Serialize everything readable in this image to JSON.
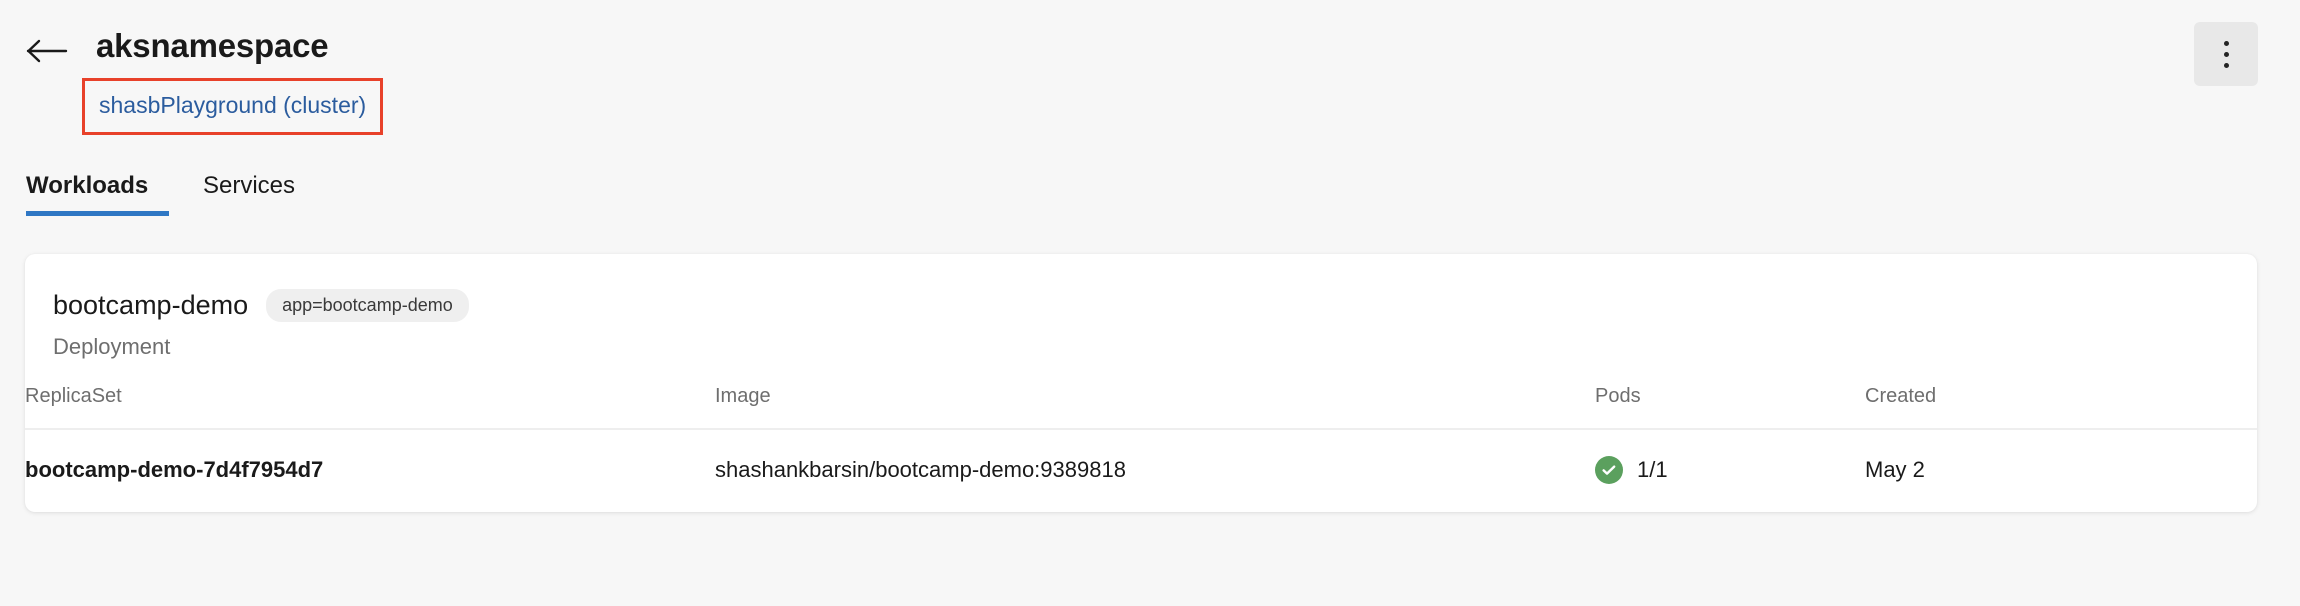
{
  "header": {
    "back_icon": "arrow-left-icon",
    "title": "aksnamespace",
    "cluster_link": "shasbPlayground (cluster)",
    "annotation_color": "#e8412a",
    "link_color": "#2b5c9e",
    "more_menu_icon": "kebab-menu-icon"
  },
  "tabs": {
    "items": [
      {
        "label": "Workloads",
        "active": true
      },
      {
        "label": "Services",
        "active": false
      }
    ],
    "active_underline_color": "#2f77c4",
    "filter_icon": "filter-funnel-icon"
  },
  "workload_card": {
    "name": "bootcamp-demo",
    "label_pill": "app=bootcamp-demo",
    "kind": "Deployment",
    "table": {
      "columns": [
        "ReplicaSet",
        "Image",
        "Pods",
        "Created"
      ],
      "rows": [
        {
          "replicaset": "bootcamp-demo-7d4f7954d7",
          "image": "shashankbarsin/bootcamp-demo:9389818",
          "pods": "1/1",
          "pods_status": "healthy",
          "pods_status_color": "#5ba05e",
          "created": "May 2"
        }
      ]
    }
  }
}
